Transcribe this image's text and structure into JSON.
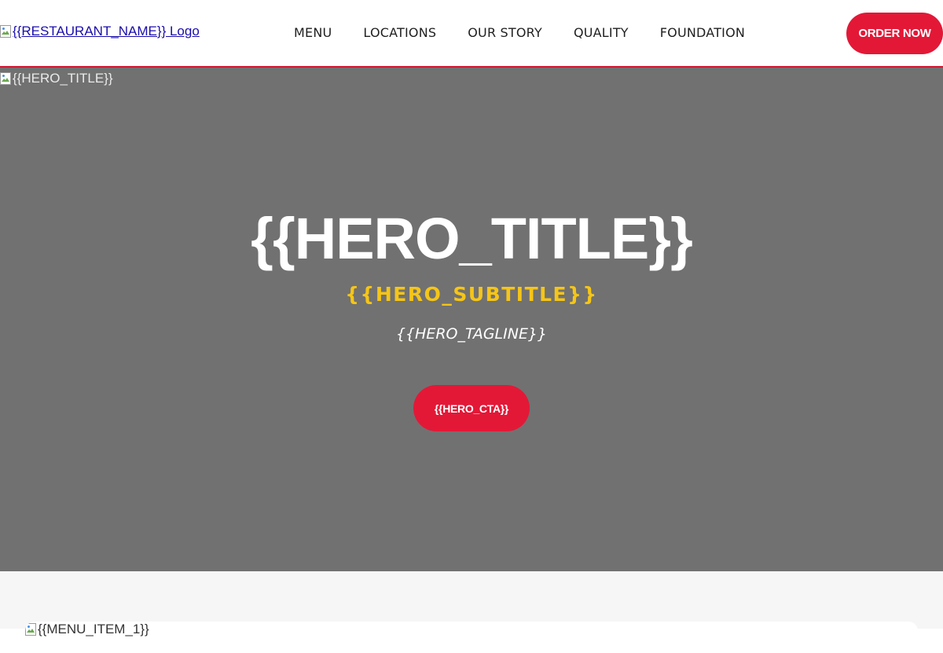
{
  "header": {
    "logo_alt": "{{RESTAURANT_NAME}} Logo",
    "nav": [
      {
        "label": "MENU"
      },
      {
        "label": "LOCATIONS"
      },
      {
        "label": "OUR STORY"
      },
      {
        "label": "QUALITY"
      },
      {
        "label": "FOUNDATION"
      }
    ],
    "order_button": "ORDER NOW"
  },
  "hero": {
    "image_alt": "{{HERO_TITLE}}",
    "title": "{{HERO_TITLE}}",
    "subtitle": "{{HERO_SUBTITLE}}",
    "tagline": "{{HERO_TAGLINE}}",
    "cta": "{{HERO_CTA}}"
  },
  "menu_section": {
    "items": [
      {
        "image_alt": "{{MENU_ITEM_1}}"
      }
    ]
  },
  "colors": {
    "brand_red": "#e31837",
    "accent_yellow": "#f5c518",
    "hero_bg": "#717171",
    "link_blue": "#1a0dab"
  },
  "icons": {
    "broken_image": "broken-image-icon"
  }
}
